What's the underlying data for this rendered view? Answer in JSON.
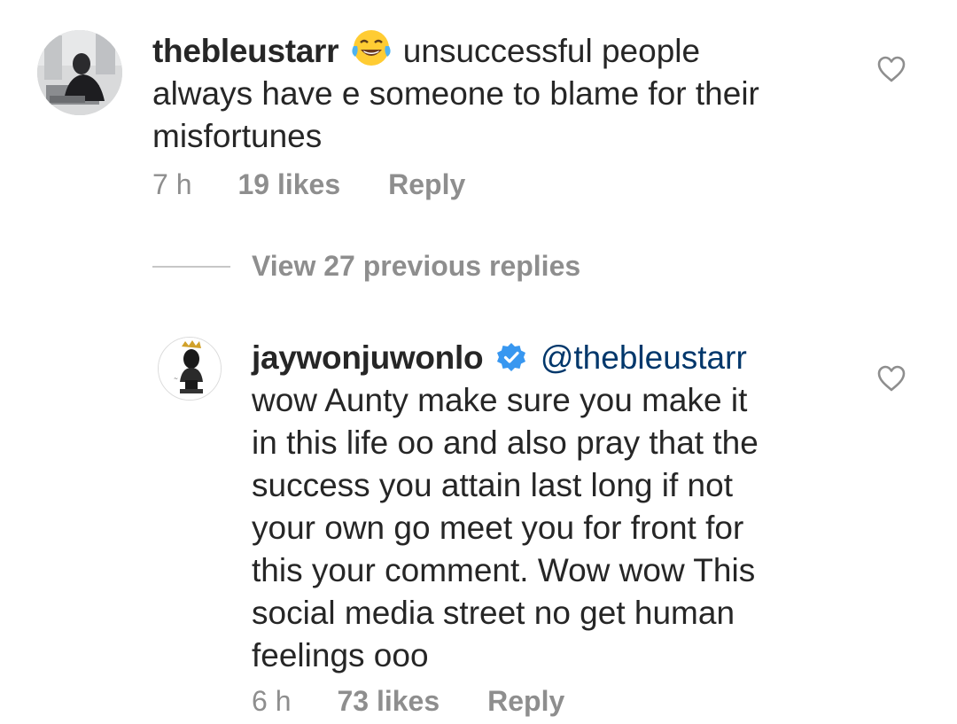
{
  "comment1": {
    "username": "thebleustarr",
    "emoji": "face-with-tears-of-joy",
    "text": "unsuccessful people",
    "text_lines": [
      "always have e someone to blame for their",
      "misfortunes"
    ],
    "time": "7 h",
    "likes": "19 likes",
    "reply_label": "Reply"
  },
  "view_replies": {
    "label": "View 27 previous replies"
  },
  "comment2": {
    "username": "jaywonjuwonlo",
    "verified": true,
    "mention": "@thebleustarr",
    "text_lines": [
      "wow Aunty make sure you make it",
      "in this life oo and also pray that the",
      "success you attain last long if not",
      "your own go meet you for front for",
      "this your comment. Wow wow This",
      "social media street no get human",
      "feelings ooo"
    ],
    "time": "6 h",
    "likes": "73 likes",
    "reply_label": "Reply"
  },
  "icons": {
    "like": "heart-outline-icon",
    "verified": "verified-badge-icon"
  },
  "colors": {
    "text": "#262626",
    "meta": "#8e8e8e",
    "verified": "#3897f0",
    "mention": "#00376b"
  }
}
